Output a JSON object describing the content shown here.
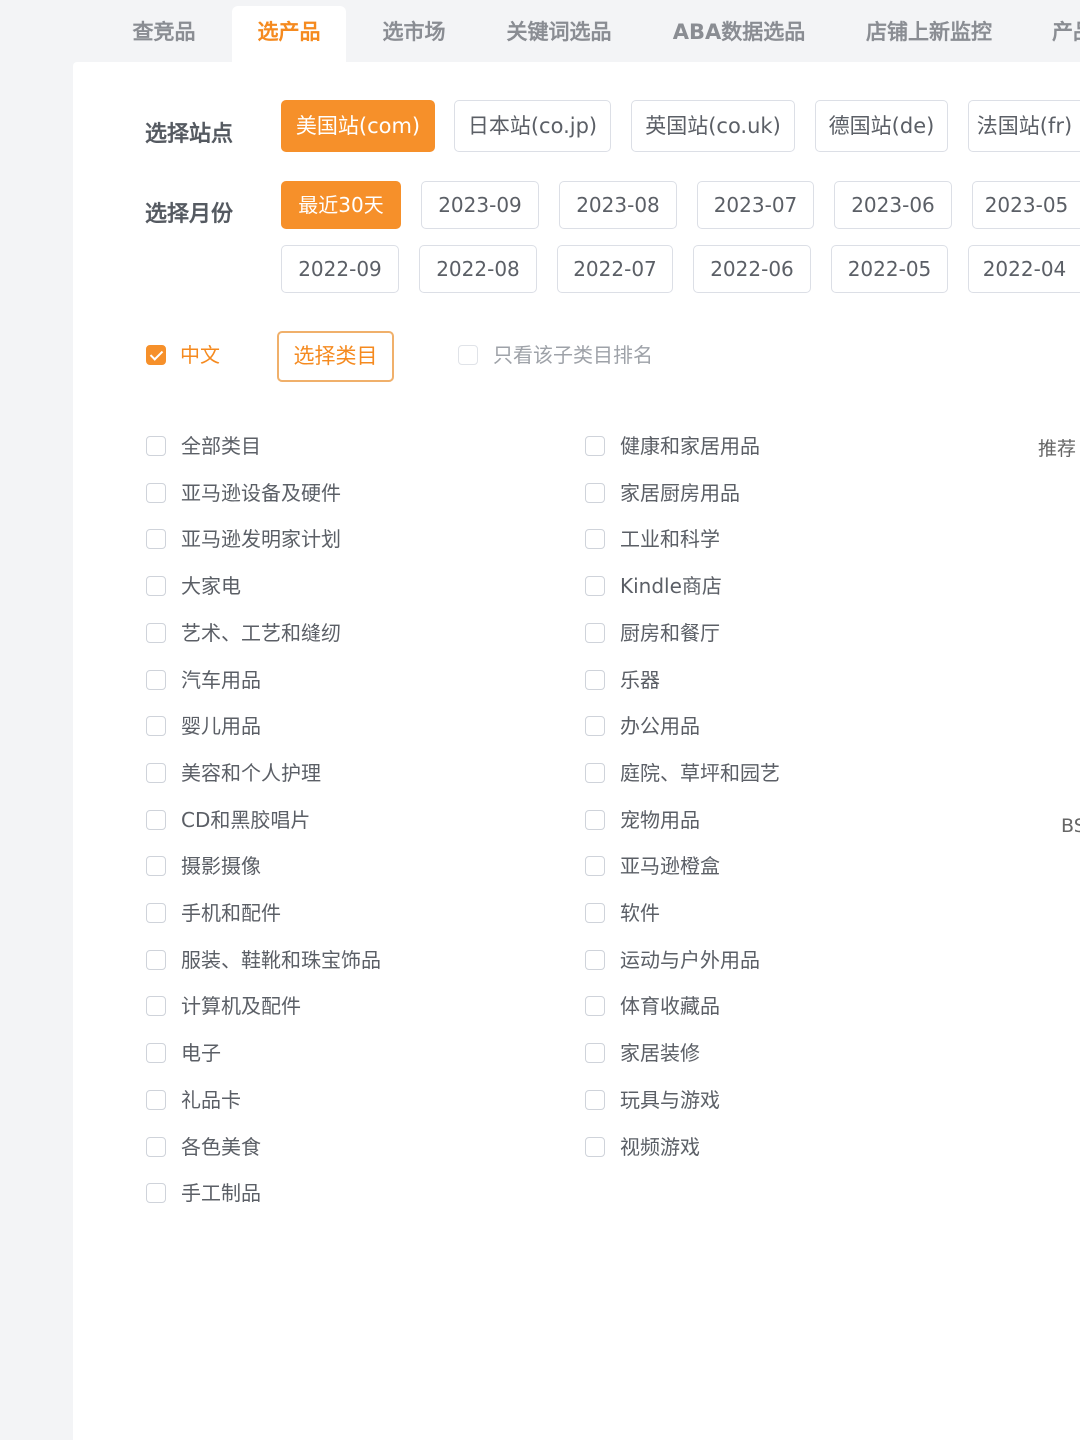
{
  "tabs": [
    "查竞品",
    "选产品",
    "选市场",
    "关键词选品",
    "ABA数据选品",
    "店铺上新监控",
    "产品"
  ],
  "active_tab": "选产品",
  "site": {
    "label": "选择站点",
    "options": [
      "美国站(com)",
      "日本站(co.jp)",
      "英国站(co.uk)",
      "德国站(de)",
      "法国站(fr)"
    ],
    "selected": "美国站(com)"
  },
  "month": {
    "label": "选择月份",
    "row1": [
      "最近30天",
      "2023-09",
      "2023-08",
      "2023-07",
      "2023-06",
      "2023-05"
    ],
    "row2": [
      "2022-09",
      "2022-08",
      "2022-07",
      "2022-06",
      "2022-05",
      "2022-04"
    ],
    "selected": "最近30天"
  },
  "filters": {
    "chinese_label": "中文",
    "chinese_checked": true,
    "category_button": "选择类目",
    "subcategory_only_label": "只看该子类目排名",
    "subcategory_only_checked": false
  },
  "categories_left": [
    "全部类目",
    "亚马逊设备及硬件",
    "亚马逊发明家计划",
    "大家电",
    "艺术、工艺和缝纫",
    "汽车用品",
    "婴儿用品",
    "美容和个人护理",
    "CD和黑胶唱片",
    "摄影摄像",
    "手机和配件",
    "服装、鞋靴和珠宝饰品",
    "计算机及配件",
    "电子",
    "礼品卡",
    "各色美食",
    "手工制品"
  ],
  "categories_right": [
    "健康和家居用品",
    "家居厨房用品",
    "工业和科学",
    "Kindle商店",
    "厨房和餐厅",
    "乐器",
    "办公用品",
    "庭院、草坪和园艺",
    "宠物用品",
    "亚马逊橙盒",
    "软件",
    "运动与户外用品",
    "体育收藏品",
    "家居装修",
    "玩具与游戏",
    "视频游戏"
  ],
  "side": {
    "recommend": "推荐",
    "bs": "BS"
  },
  "colors": {
    "accent": "#f6902a",
    "active_tab_text": "#f58a1f"
  }
}
